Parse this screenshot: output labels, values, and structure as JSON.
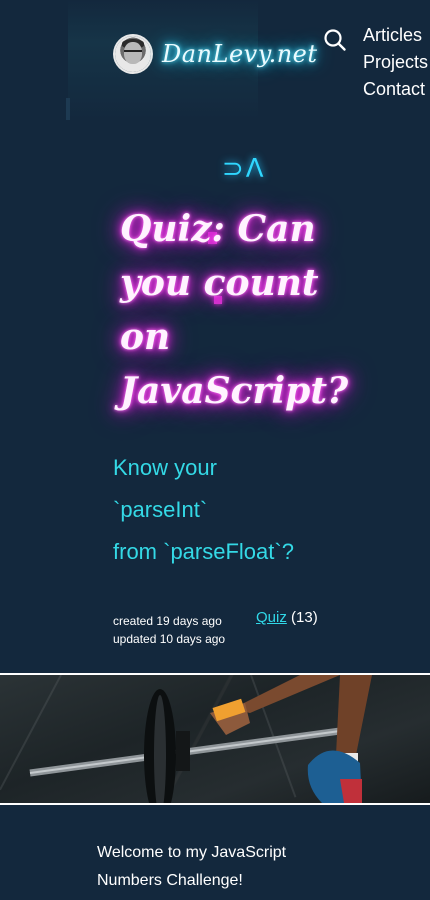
{
  "header": {
    "logo_text": "DanLevy.net",
    "nav": [
      "Articles",
      "Projects",
      "Contact"
    ]
  },
  "hero": {
    "title": "Quiz: Can you count on JavaScript?",
    "subtitle_lines": [
      "Know your",
      "`parseInt`",
      "from `parseFloat`?"
    ],
    "created": "created 19 days ago",
    "updated": "updated 10 days ago",
    "tag_label": "Quiz",
    "tag_count": "(13)"
  },
  "intro": {
    "text_lines": [
      "Welcome to my JavaScript",
      "Numbers Challenge!"
    ]
  },
  "colors": {
    "background": "#13283d",
    "accent_cyan": "#34d9e6",
    "neon_pink": "#ff32ee",
    "neon_blue": "#2cd3ff"
  },
  "icons": {
    "search": "search-icon"
  }
}
